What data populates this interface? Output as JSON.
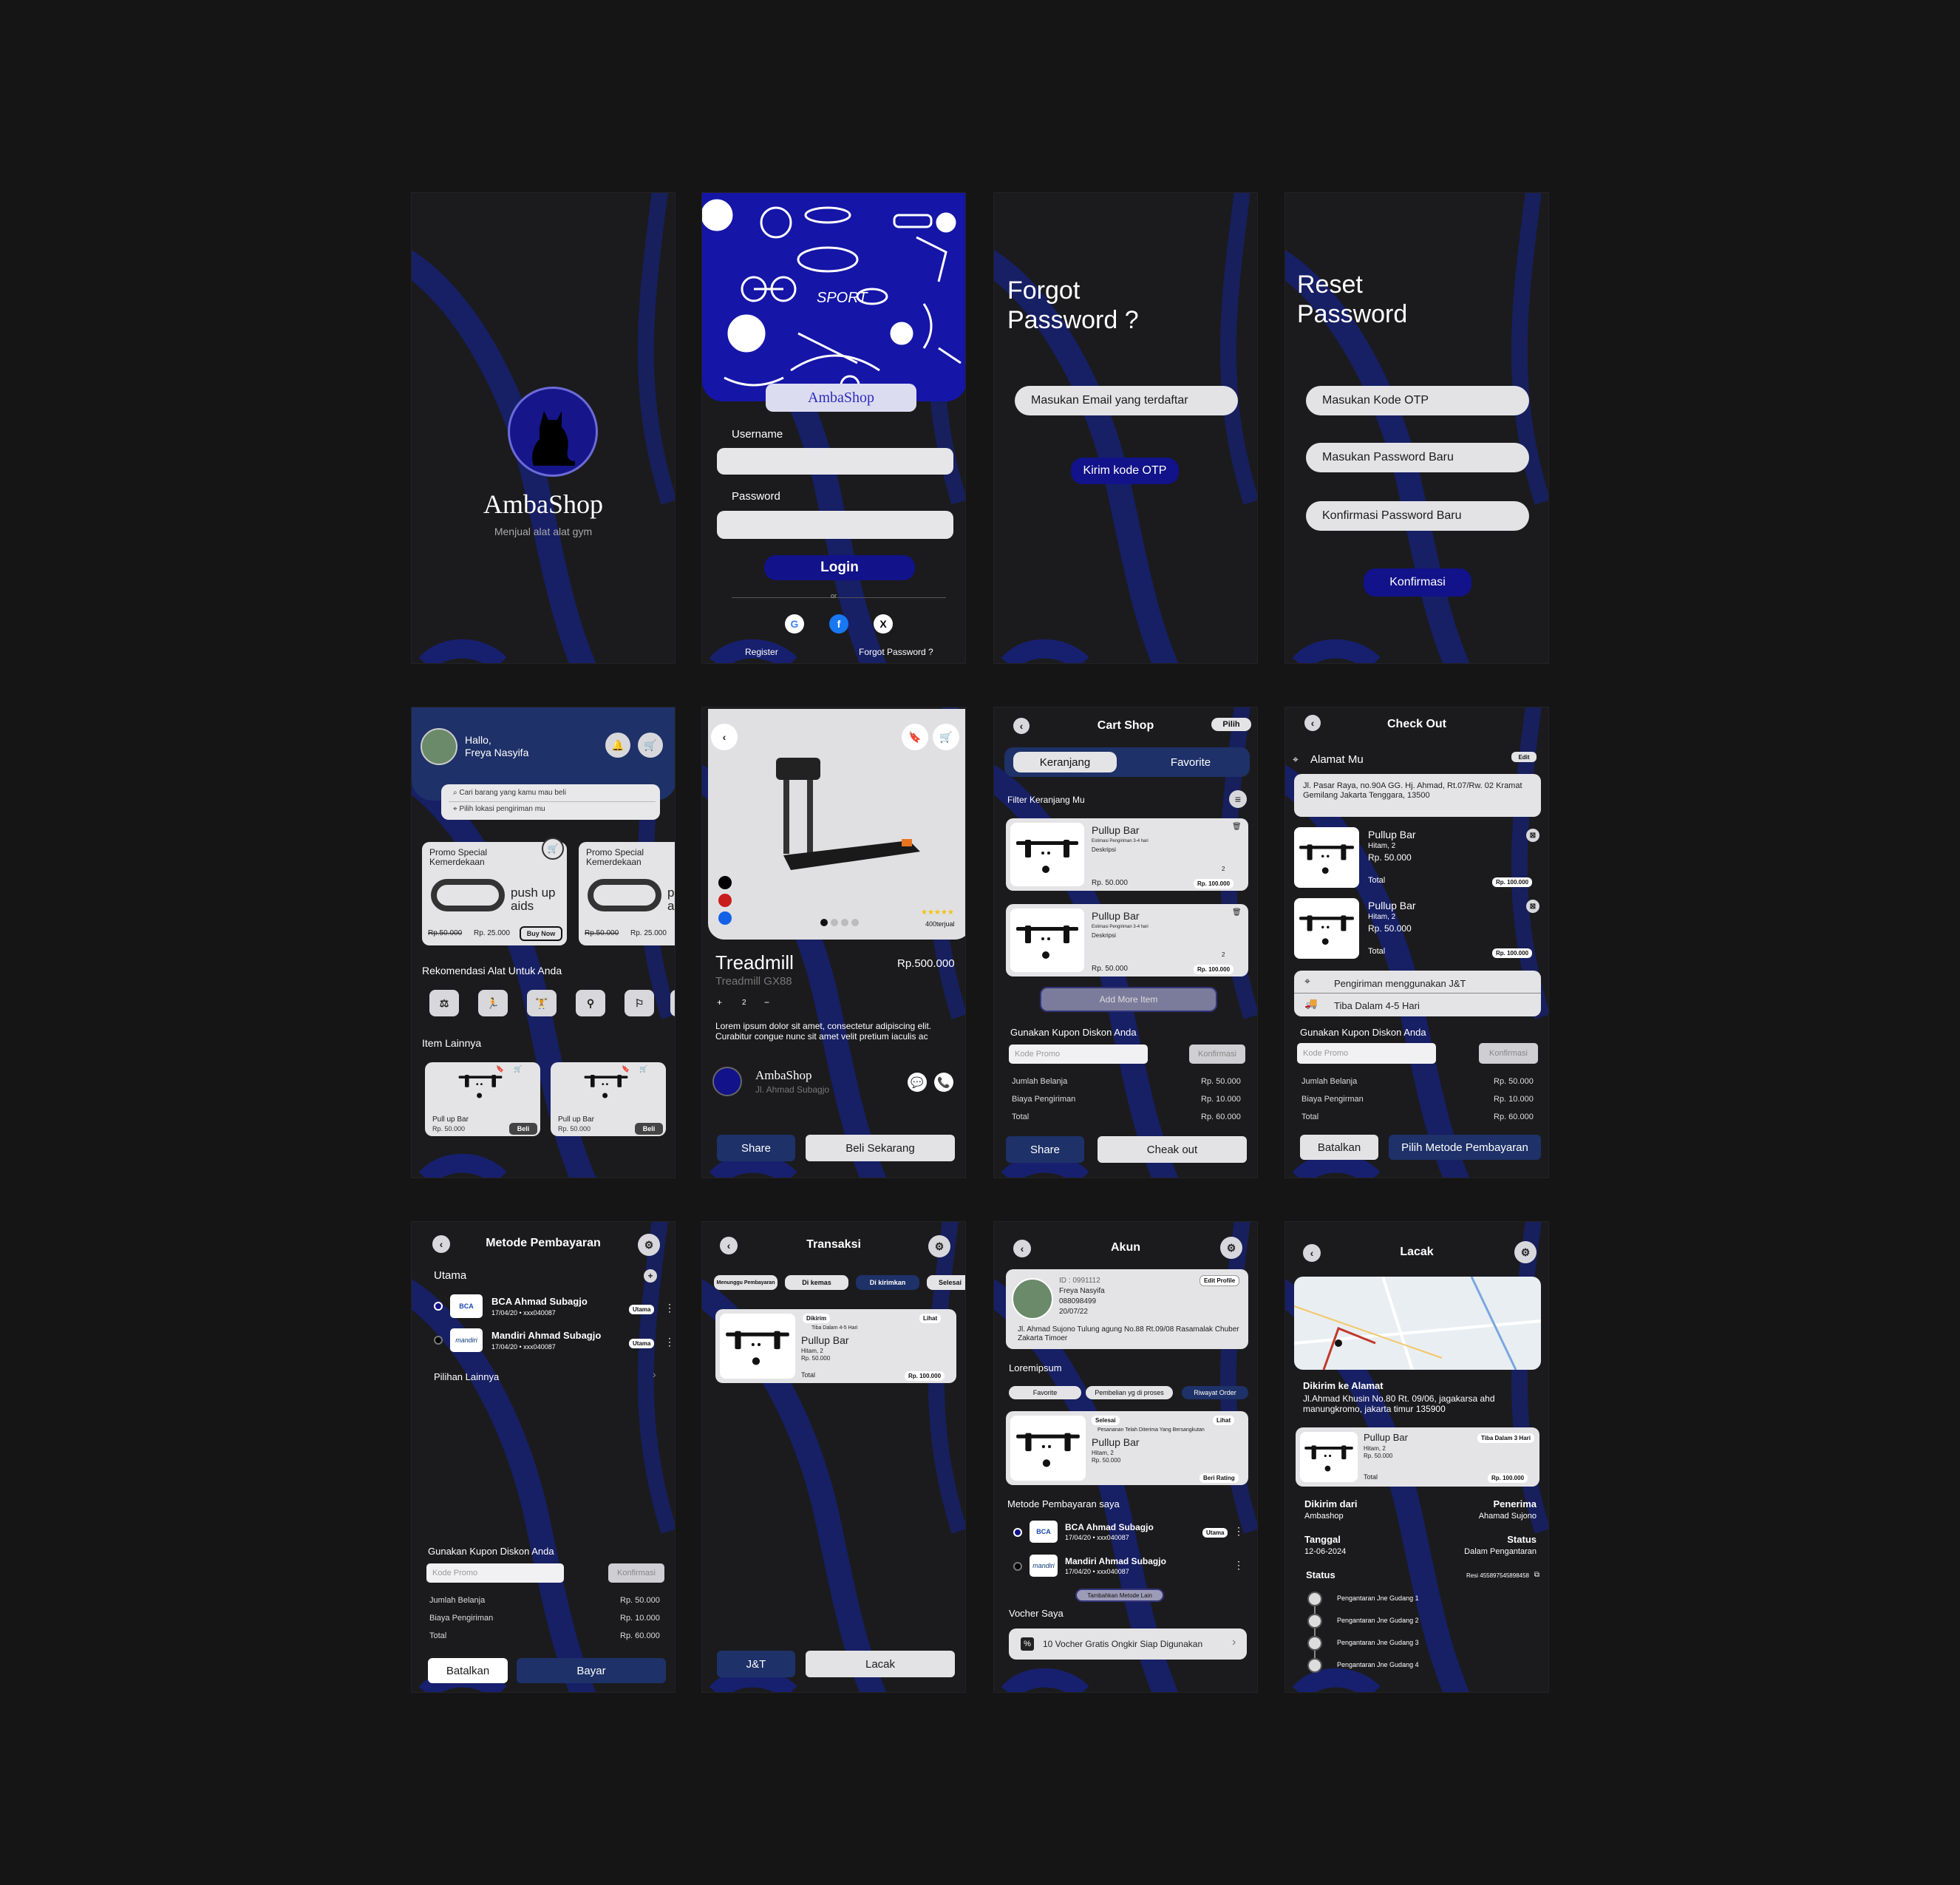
{
  "splash": {
    "brand": "AmbaShop",
    "tagline": "Menjual alat alat gym"
  },
  "login": {
    "brand": "AmbaShop",
    "username_label": "Username",
    "password_label": "Password",
    "login_button": "Login",
    "or": "or",
    "register": "Register",
    "forgot": "Forgot Password ?",
    "art_text": "SPORT"
  },
  "forgot": {
    "title_l1": "Forgot",
    "title_l2": "Password ?",
    "email_placeholder": "Masukan Email yang terdaftar",
    "send_button": "Kirim kode OTP"
  },
  "reset": {
    "title_l1": "Reset",
    "title_l2": "Password",
    "otp_placeholder": "Masukan  Kode OTP",
    "new_placeholder": "Masukan Password Baru",
    "confirm_placeholder": "Konfirmasi Password Baru",
    "confirm_button": "Konfirmasi"
  },
  "home": {
    "greeting": "Hallo,",
    "name": "Freya Nasyifa",
    "search_placeholder": "Cari barang yang kamu mau beli",
    "location_placeholder": "Pilih lokasi pengiriman mu",
    "promos": [
      {
        "title": "Promo Special Kemerdekaan",
        "product": "push up aids",
        "old_price": "Rp.50.000",
        "new_price": "Rp. 25.000",
        "cta": "Buy Now"
      },
      {
        "title": "Promo Special Kemerdekaan",
        "product": "p a",
        "old_price": "Rp.50.000",
        "new_price": "Rp. 25.000"
      }
    ],
    "recommend_title": "Rekomendasi Alat Untuk Anda",
    "items_title": "Item Lainnya",
    "items": [
      {
        "name": "Pull up Bar",
        "price": "Rp. 50.000",
        "cta": "Beli"
      },
      {
        "name": "Pull up Bar",
        "price": "Rp. 50.000",
        "cta": "Beli"
      }
    ]
  },
  "detail": {
    "name": "Treadmill",
    "price": "Rp.500.000",
    "model": "Treadmill GX88",
    "qty": "2",
    "sold": "400terjual",
    "description": "Lorem ipsum dolor sit amet, consectetur adipiscing elit. Curabitur congue nunc sit amet velit pretium iaculis ac",
    "seller": "AmbaShop",
    "seller_address": "Jl. Ahmad Subagjo",
    "share": "Share",
    "buy": "Beli Sekarang"
  },
  "cart": {
    "title": "Cart Shop",
    "select": "Pilih",
    "tab_cart": "Keranjang",
    "tab_fav": "Favorite",
    "filter": "Filter Keranjang Mu",
    "items": [
      {
        "name": "Pullup Bar",
        "est": "Estimasi Pengiriman 3-4 hari",
        "desc": "Deskripsi",
        "qty": "2",
        "price": "Rp. 50.000",
        "total": "Rp. 100.000"
      },
      {
        "name": "Pullup Bar",
        "est": "Estimasi Pengiriman 3-4 hari",
        "desc": "Deskripsi",
        "qty": "2",
        "price": "Rp. 50.000",
        "total": "Rp. 100.000"
      }
    ],
    "add_more": "Add More Item",
    "coupon_title": "Gunakan Kupon Diskon Anda",
    "coupon_placeholder": "Kode Promo",
    "coupon_confirm": "Konfirmasi",
    "summary": [
      {
        "label": "Jumlah Belanja",
        "value": "Rp. 50.000"
      },
      {
        "label": "Biaya Pengiriman",
        "value": "Rp. 10.000"
      },
      {
        "label": "Total",
        "value": "Rp. 60.000"
      }
    ],
    "share": "Share",
    "checkout": "Cheak out"
  },
  "checkout": {
    "title": "Check Out",
    "address_title": "Alamat  Mu",
    "edit": "Edit",
    "address": "Jl. Pasar Raya, no.90A GG. Hj. Ahmad, Rt.07/Rw. 02 Kramat Gemilang Jakarta Tenggara, 13500",
    "items": [
      {
        "name": "Pullup Bar",
        "variant": "Hitam, 2",
        "price": "Rp. 50.000",
        "total_label": "Total",
        "total": "Rp. 100.000"
      },
      {
        "name": "Pullup Bar",
        "variant": "Hitam, 2",
        "price": "Rp. 50.000",
        "total_label": "Total",
        "total": "Rp. 100.000"
      }
    ],
    "shipping": "Pengiriman menggunakan J&T",
    "eta": "Tiba Dalam 4-5 Hari",
    "coupon_title": "Gunakan Kupon Diskon Anda",
    "coupon_placeholder": "Kode Promo",
    "coupon_confirm": "Konfirmasi",
    "summary": [
      {
        "label": "Jumlah Belanja",
        "value": "Rp. 50.000"
      },
      {
        "label": "Biaya Pengirman",
        "value": "Rp. 10.000"
      },
      {
        "label": "Total",
        "value": "Rp. 60.000"
      }
    ],
    "cancel": "Batalkan",
    "pay_method": "Pilih Metode Pembayaran"
  },
  "payment": {
    "title": "Metode Pembayaran",
    "primary": "Utama",
    "methods": [
      {
        "name": "BCA Ahmad Subagjo",
        "detail": "17/04/20 • xxx040087",
        "badge": "Utama",
        "logo": "BCA"
      },
      {
        "name": "Mandiri Ahmad Subagjo",
        "detail": "17/04/20 • xxx040087",
        "badge": "Utama",
        "logo": "mandiri"
      }
    ],
    "other": "Pilihan Lainnya",
    "coupon_title": "Gunakan Kupon Diskon Anda",
    "coupon_placeholder": "Kode Promo",
    "coupon_confirm": "Konfirmasi",
    "summary": [
      {
        "label": "Jumlah Belanja",
        "value": "Rp. 50.000"
      },
      {
        "label": "Biaya Pengiriman",
        "value": "Rp. 10.000"
      },
      {
        "label": "Total",
        "value": "Rp. 60.000"
      }
    ],
    "cancel": "Batalkan",
    "pay": "Bayar"
  },
  "transaksi": {
    "title": "Transaksi",
    "tabs": [
      "Menunggu Pembayaran",
      "Di kemas",
      "Di kirimkan",
      "Selesai"
    ],
    "item": {
      "status": "Dikirim",
      "view": "Lihat",
      "eta": "Tiba Dalam 4-5 Hari",
      "name": "Pullup Bar",
      "variant": "Hitam, 2",
      "price": "Rp. 50.000",
      "total_label": "Total",
      "total": "Rp. 100.000"
    },
    "courier": "J&T",
    "track": "Lacak"
  },
  "akun": {
    "title": "Akun",
    "id": "ID : 0991112",
    "name": "Freya Nasyifa",
    "phone": "088098499",
    "dob": "20/07/22",
    "edit": "Edit Profile",
    "address": "Jl. Ahmad Sujono Tulung agung No.88 Rt.09/08 Rasamalak Chuber Zakarta Timoer",
    "section": "Loremipsum",
    "tabs": [
      "Favorite",
      "Pembelian yg di proses",
      "Riwayat Order"
    ],
    "order": {
      "status": "Selesai",
      "view": "Lihat",
      "note": "Pesananan Telah Diterima Yang Bersangkutan",
      "name": "Pullup Bar",
      "variant": "Hitam, 2",
      "price": "Rp. 50.000",
      "rate": "Beri Rating"
    },
    "pay_title": "Metode Pembayaran saya",
    "methods": [
      {
        "name": "BCA Ahmad Subagjo",
        "detail": "17/04/20 • xxx040087",
        "badge": "Utama",
        "logo": "BCA"
      },
      {
        "name": "Mandiri Ahmad Subagjo",
        "detail": "17/04/20 • xxx040087",
        "logo": "mandiri"
      }
    ],
    "add_method": "Tambahkan Metode Lain",
    "voucher_title": "Vocher Saya",
    "voucher": "10 Vocher Gratis Ongkir Siap Digunakan"
  },
  "lacak": {
    "title": "Lacak",
    "sent_to": "Dikirim ke Alamat",
    "address": "Jl.Ahmad Khusin No.80 Rt. 09/06, jagakarsa ahd manungkromo, jakarta timur 135900",
    "item": {
      "name": "Pullup Bar",
      "variant": "Hitam, 2",
      "price": "Rp. 50.000",
      "eta": "Tiba Dalam 3 Hari",
      "total_label": "Total",
      "total": "Rp. 100.000"
    },
    "from_label": "Dikirim dari",
    "from": "Ambashop",
    "to_label": "Penerima",
    "to": "Ahamad Sujono",
    "date_label": "Tanggal",
    "date": "12-06-2024",
    "status_label": "Status",
    "status": "Dalam Pengantaran",
    "history_title": "Status",
    "resi": "Resi 455897545898458",
    "history": [
      "Pengantaran Jne Gudang 1",
      "Pengantaran Jne Gudang 2",
      "Pengantaran Jne Gudang 3",
      "Pengantaran Jne Gudang 4"
    ]
  },
  "colors": {
    "bg": "#151515",
    "screen": "#1b1b1d",
    "accent": "#12128a",
    "navy": "#1e3168",
    "swoosh": "#1a2580"
  }
}
